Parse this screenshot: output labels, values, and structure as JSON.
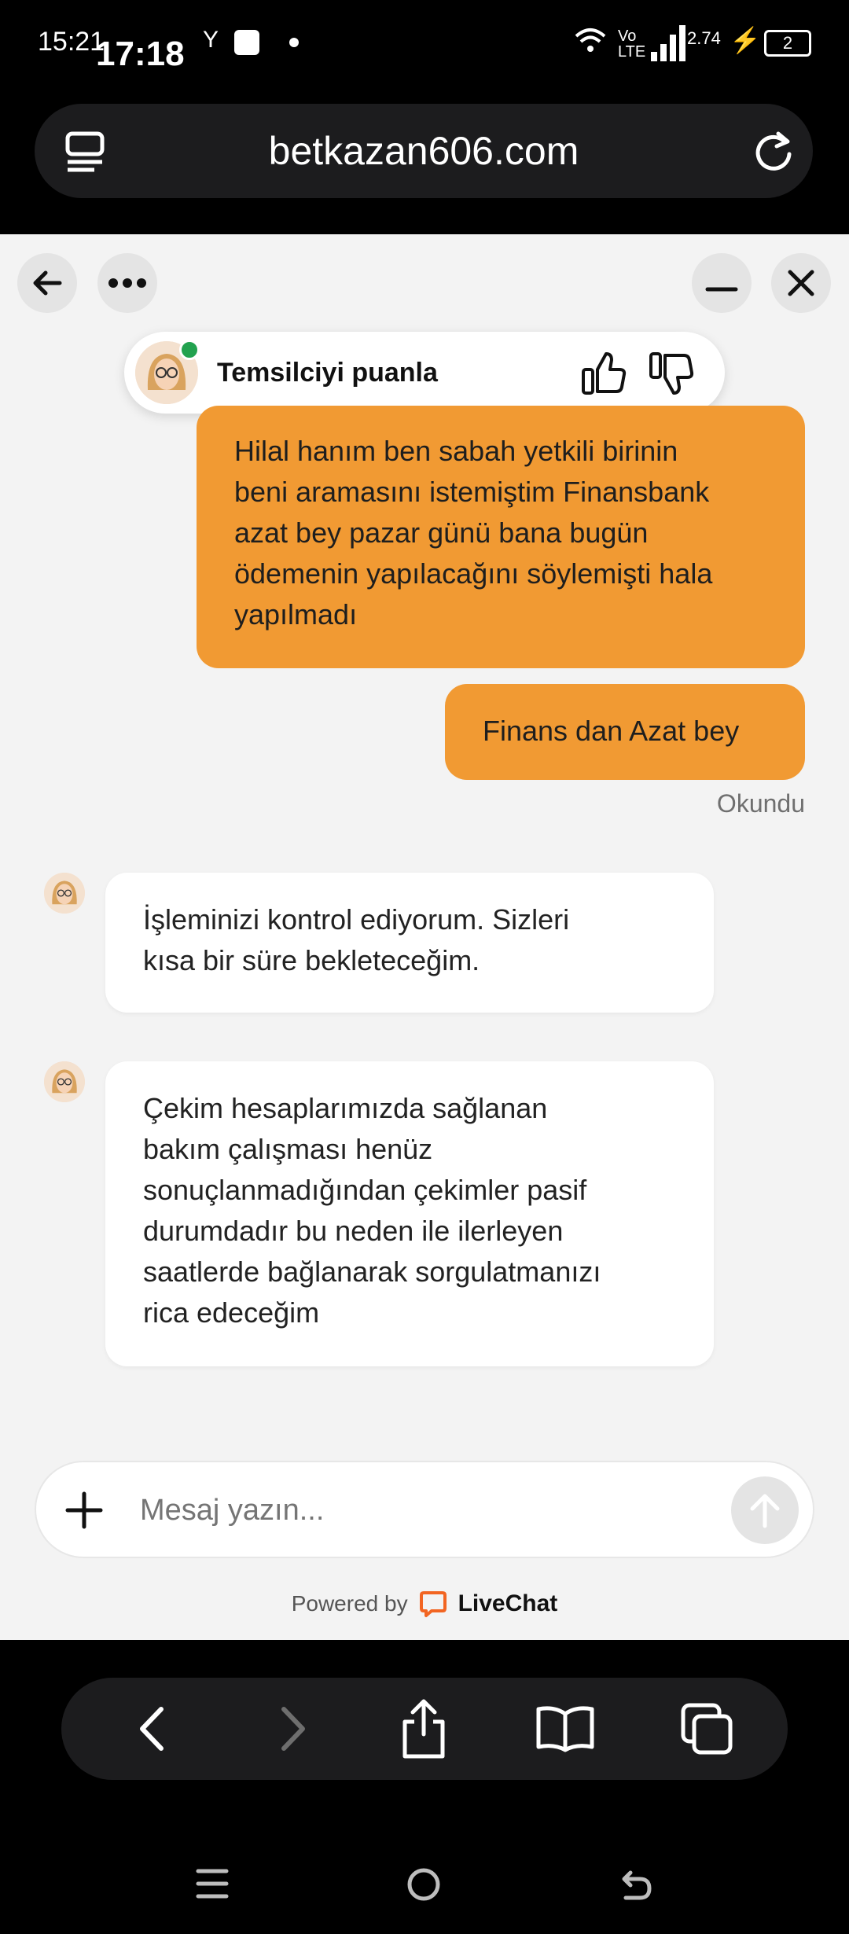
{
  "status_bar": {
    "time_back": "15:21",
    "time_front": "17:18",
    "net_speed": "2.74",
    "lte": "Vo LTE",
    "battery": "2"
  },
  "browser": {
    "url": "betkazan606.com"
  },
  "chat": {
    "rate_label": "Temsilciyi puanla",
    "messages": [
      {
        "from": "user",
        "lines": [
          "Hilal hanım ben sabah yetkili birinin",
          "beni aramasını istemiştim Finansbank",
          "azat bey pazar günü bana bugün",
          "ödemenin yapılacağını söylemişti hala",
          "yapılmadı"
        ]
      },
      {
        "from": "user",
        "lines": [
          "Finans dan Azat bey"
        ]
      },
      {
        "from": "agent",
        "lines": [
          "İşleminizi kontrol ediyorum. Sizleri",
          "kısa bir süre bekleteceğim."
        ]
      },
      {
        "from": "agent",
        "lines": [
          "Çekim hesaplarımızda sağlanan",
          "bakım çalışması henüz",
          "sonuçlanmadığından çekimler pasif",
          "durumdadır bu neden ile ilerleyen",
          "saatlerde bağlanarak sorgulatmanızı",
          "rica edeceğim"
        ]
      }
    ],
    "read_status": "Okundu",
    "composer_placeholder": "Mesaj yazın...",
    "powered_by": "Powered by",
    "brand": "LiveChat",
    "brand_color": "#f26522",
    "accent": "#f19a33"
  }
}
